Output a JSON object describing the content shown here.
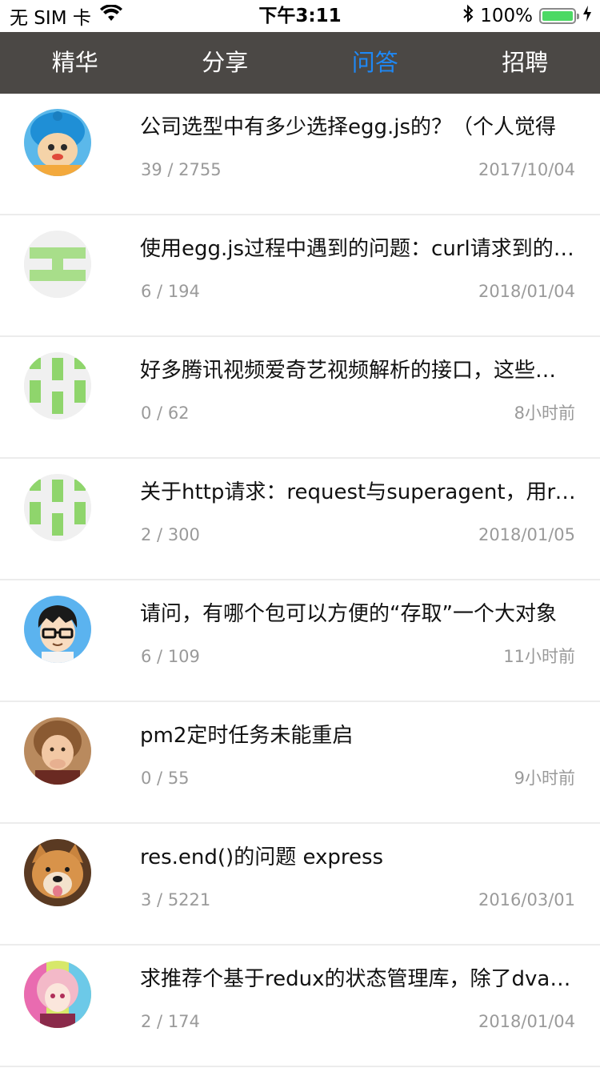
{
  "status_bar": {
    "carrier": "无 SIM 卡",
    "time": "下午3:11",
    "battery": "100%",
    "battery_level": 1.0
  },
  "tabs": [
    {
      "label": "精华",
      "active": false
    },
    {
      "label": "分享",
      "active": false
    },
    {
      "label": "问答",
      "active": true
    },
    {
      "label": "招聘",
      "active": false
    }
  ],
  "accent_color": "#1e88f5",
  "posts": [
    {
      "title": "公司选型中有多少选择egg.js的？（个人觉得",
      "replies": "39",
      "views": "2755",
      "time": "2017/10/04",
      "avatar": "cartoon-blue-hat"
    },
    {
      "title": "使用egg.js过程中遇到的问题：curl请求到的数据",
      "replies": "6",
      "views": "194",
      "time": "2018/01/04",
      "avatar": "identicon-green-1"
    },
    {
      "title": "好多腾讯视频爱奇艺视频解析的接口，这些接口",
      "replies": "0",
      "views": "62",
      "time": "8小时前",
      "avatar": "identicon-green-2"
    },
    {
      "title": "关于http请求：request与superagent，用request",
      "replies": "2",
      "views": "300",
      "time": "2018/01/05",
      "avatar": "identicon-green-2"
    },
    {
      "title": "请问，有哪个包可以方便的“存取”一个大对象",
      "replies": "6",
      "views": "109",
      "time": "11小时前",
      "avatar": "cartoon-glasses"
    },
    {
      "title": "pm2定时任务未能重启",
      "replies": "0",
      "views": "55",
      "time": "9小时前",
      "avatar": "photo-child"
    },
    {
      "title": "res.end()的问题 express",
      "replies": "3",
      "views": "5221",
      "time": "2016/03/01",
      "avatar": "photo-dog"
    },
    {
      "title": "求推荐个基于redux的状态管理库，除了dva之外",
      "replies": "2",
      "views": "174",
      "time": "2018/01/04",
      "avatar": "anime-girl"
    }
  ]
}
